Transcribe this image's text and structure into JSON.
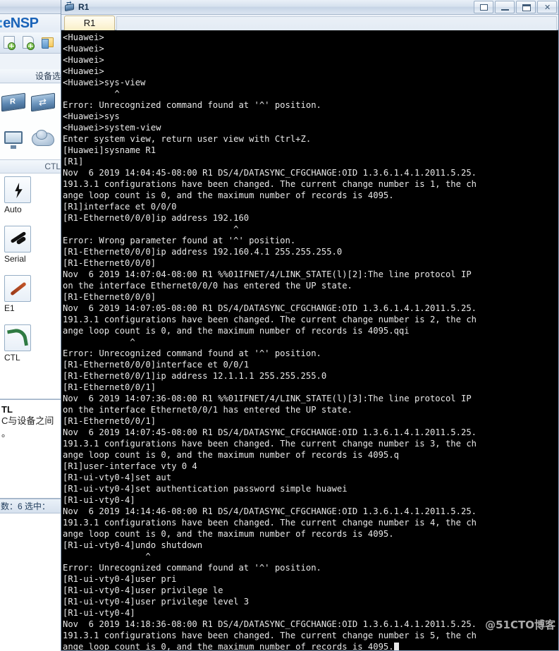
{
  "ensp": {
    "logo_text": "eNSP",
    "toolbar_icons": [
      "new-topology-icon",
      "open-topology-icon",
      "save-topology-icon"
    ],
    "device_panel_header": "设备选",
    "device_icons": [
      "router-icon",
      "switch-icon",
      "pc-icon",
      "cloud-icon"
    ],
    "ctl_header": "CTL",
    "connection_tools": [
      {
        "label": "Auto",
        "icon": "lightning-bolt-icon"
      },
      {
        "label": "Serial",
        "icon": "serial-cable-icon"
      },
      {
        "label": "E1",
        "icon": "e1-cable-icon"
      },
      {
        "label": "CTL",
        "icon": "ctl-cable-icon"
      }
    ],
    "description": {
      "title": "TL",
      "line1": "C与设备之间",
      "line2": "。"
    },
    "statusbar": "数：6 选中："
  },
  "cli_window": {
    "title": "R1",
    "title_icon": "router-icon",
    "window_buttons": [
      {
        "name": "restore-button",
        "glyph": "restore"
      },
      {
        "name": "minimize-button",
        "glyph": "minimize"
      },
      {
        "name": "maximize-button",
        "glyph": "maximize"
      },
      {
        "name": "close-button",
        "glyph": "close"
      }
    ],
    "tabs": [
      {
        "label": "R1",
        "active": true
      }
    ],
    "watermark": "@51CTO博客",
    "terminal_lines": [
      "<Huawei>",
      "<Huawei>",
      "<Huawei>",
      "<Huawei>",
      "<Huawei>sys-view",
      "          ^",
      "Error: Unrecognized command found at '^' position.",
      "<Huawei>sys",
      "<Huawei>system-view",
      "Enter system view, return user view with Ctrl+Z.",
      "[Huawei]sysname R1",
      "[R1]",
      "Nov  6 2019 14:04:45-08:00 R1 DS/4/DATASYNC_CFGCHANGE:OID 1.3.6.1.4.1.2011.5.25.",
      "191.3.1 configurations have been changed. The current change number is 1, the ch",
      "ange loop count is 0, and the maximum number of records is 4095.",
      "[R1]interface et 0/0/0",
      "[R1-Ethernet0/0/0]ip address 192.160",
      "                                 ^",
      "Error: Wrong parameter found at '^' position.",
      "[R1-Ethernet0/0/0]ip address 192.160.4.1 255.255.255.0",
      "[R1-Ethernet0/0/0]",
      "Nov  6 2019 14:07:04-08:00 R1 %%01IFNET/4/LINK_STATE(l)[2]:The line protocol IP",
      "on the interface Ethernet0/0/0 has entered the UP state.",
      "[R1-Ethernet0/0/0]",
      "Nov  6 2019 14:07:05-08:00 R1 DS/4/DATASYNC_CFGCHANGE:OID 1.3.6.1.4.1.2011.5.25.",
      "191.3.1 configurations have been changed. The current change number is 2, the ch",
      "ange loop count is 0, and the maximum number of records is 4095.qqi",
      "             ^",
      "Error: Unrecognized command found at '^' position.",
      "[R1-Ethernet0/0/0]interface et 0/0/1",
      "[R1-Ethernet0/0/1]ip address 12.1.1.1 255.255.255.0",
      "[R1-Ethernet0/0/1]",
      "Nov  6 2019 14:07:36-08:00 R1 %%01IFNET/4/LINK_STATE(l)[3]:The line protocol IP",
      "on the interface Ethernet0/0/1 has entered the UP state.",
      "[R1-Ethernet0/0/1]",
      "Nov  6 2019 14:07:45-08:00 R1 DS/4/DATASYNC_CFGCHANGE:OID 1.3.6.1.4.1.2011.5.25.",
      "191.3.1 configurations have been changed. The current change number is 3, the ch",
      "ange loop count is 0, and the maximum number of records is 4095.q",
      "[R1]user-interface vty 0 4",
      "[R1-ui-vty0-4]set aut",
      "[R1-ui-vty0-4]set authentication password simple huawei",
      "[R1-ui-vty0-4]",
      "Nov  6 2019 14:14:46-08:00 R1 DS/4/DATASYNC_CFGCHANGE:OID 1.3.6.1.4.1.2011.5.25.",
      "191.3.1 configurations have been changed. The current change number is 4, the ch",
      "ange loop count is 0, and the maximum number of records is 4095.",
      "[R1-ui-vty0-4]undo shutdown",
      "                ^",
      "Error: Unrecognized command found at '^' position.",
      "[R1-ui-vty0-4]user pri",
      "[R1-ui-vty0-4]user privilege le",
      "[R1-ui-vty0-4]user privilege level 3",
      "[R1-ui-vty0-4]",
      "Nov  6 2019 14:18:36-08:00 R1 DS/4/DATASYNC_CFGCHANGE:OID 1.3.6.1.4.1.2011.5.25.",
      "191.3.1 configurations have been changed. The current change number is 5, the ch",
      "ange loop count is 0, and the maximum number of records is 4095."
    ]
  }
}
